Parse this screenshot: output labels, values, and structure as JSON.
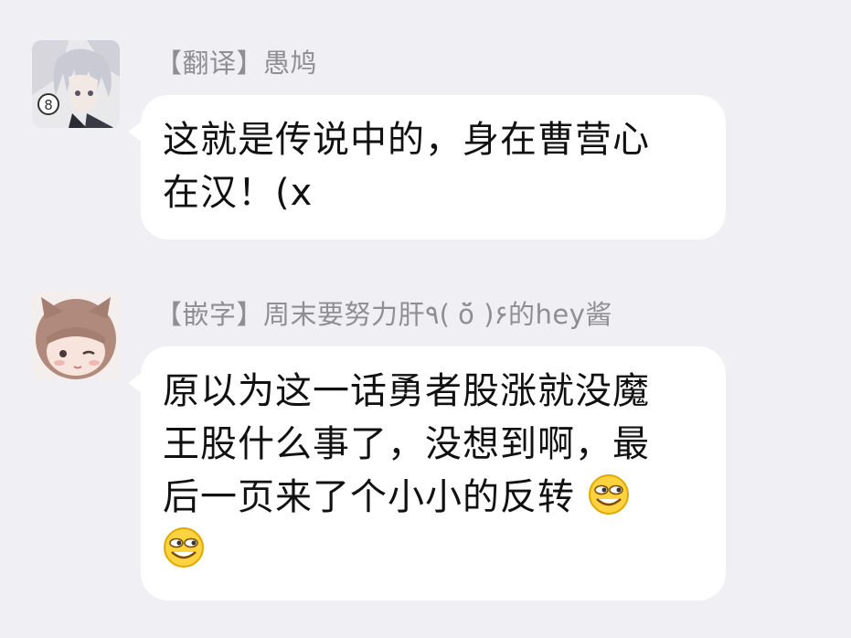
{
  "messages": [
    {
      "sender": "【翻译】愚鸠",
      "text": "这就是传说中的，身在曹营心\n在汉！(x"
    },
    {
      "sender": "【嵌字】周末要努力肝٩( ŏ̆ )۶的hey酱",
      "text": "原以为这一话勇者股涨就没魔\n王股什么事了，没想到啊，最\n后一页来了个小小的反转 ",
      "emojis": [
        "smirk-grin-emoji",
        "smirk-grin-emoji"
      ]
    }
  ],
  "colors": {
    "background": "#f0f0f4",
    "bubble": "#ffffff",
    "sender_text": "#8e8e93",
    "message_text": "#111111"
  }
}
